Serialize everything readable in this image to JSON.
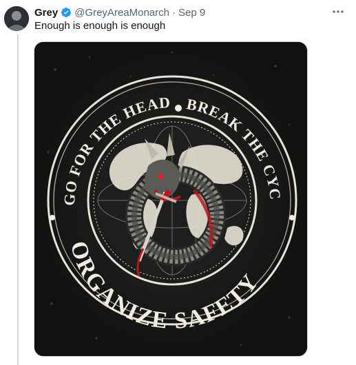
{
  "post": {
    "author_name": "Grey",
    "handle": "@GreyAreaMonarch",
    "separator": "·",
    "date": "Sep 9",
    "text": "Enough is enough is enough"
  },
  "artwork": {
    "top_left_text": "GO FOR THE HEAD",
    "top_right_text": "BREAK THE CYCLE",
    "bottom_text": "ORGANIZE SAFETY"
  },
  "icons": {
    "verified": "verified-badge-icon",
    "more": "more-options-icon"
  },
  "colors": {
    "verified": "#1d9bf0",
    "name": "#0f1419",
    "secondary": "#536471",
    "artwork_bg": "#151515",
    "artwork_ink": "#e9e4d8",
    "accent_red": "#c0151b"
  }
}
